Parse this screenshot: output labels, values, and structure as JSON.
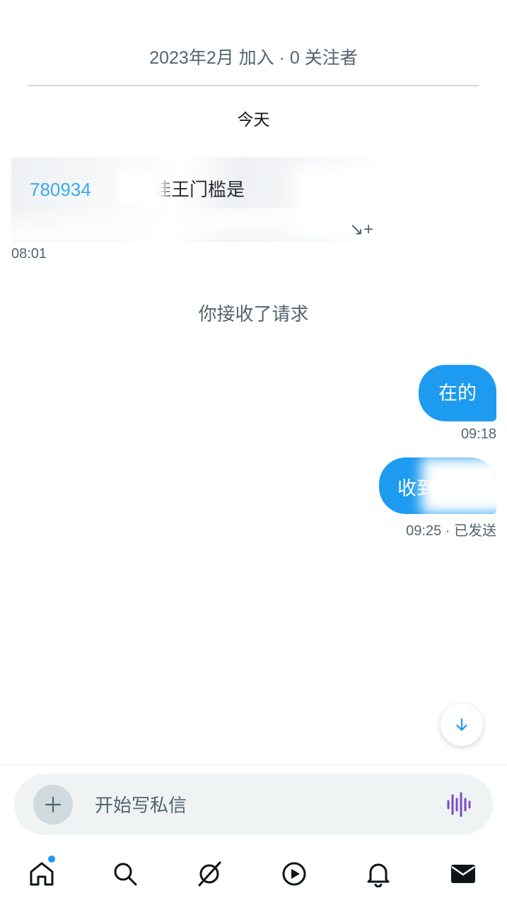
{
  "profile": {
    "meta": "2023年2月 加入 · 0 关注者"
  },
  "conversation": {
    "date_separator": "今天",
    "incoming": {
      "text_visible_number": "780934",
      "text_visible_rest": "块 娃王门槛是",
      "time": "08:01"
    },
    "system_note": "你接收了请求",
    "outgoing": [
      {
        "text": "在的",
        "time": "09:18"
      },
      {
        "text": "收到",
        "time": "09:25 · 已发送"
      }
    ]
  },
  "compose": {
    "placeholder": "开始写私信"
  },
  "colors": {
    "accent": "#1d9bf0",
    "muted": "#536471",
    "compose_bg": "#eff3f4",
    "voice": "#794bc4"
  },
  "nav": {
    "items": [
      {
        "icon": "home-icon",
        "active": false,
        "has_dot": true
      },
      {
        "icon": "search-icon"
      },
      {
        "icon": "grok-icon"
      },
      {
        "icon": "video-icon"
      },
      {
        "icon": "bell-icon"
      },
      {
        "icon": "mail-icon",
        "active": true
      }
    ]
  }
}
